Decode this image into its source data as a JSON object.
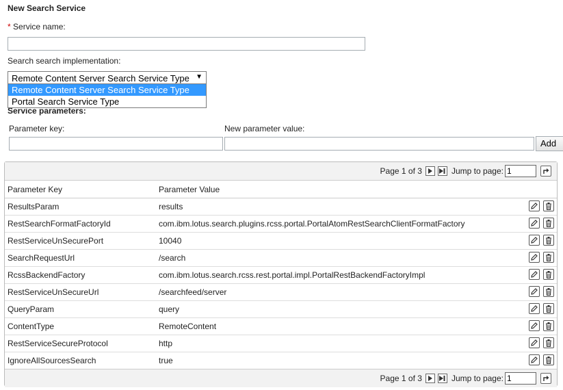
{
  "form": {
    "title": "New Search Service",
    "required_mark": "*",
    "service_name_label": "Service name:",
    "service_name_value": "",
    "impl_label": "Search search implementation:",
    "impl_selected": "Remote Content Server Search Service Type",
    "impl_options": [
      "Remote Content Server Search Service Type",
      "Portal Search Service Type"
    ],
    "params_label": "Service parameters:",
    "param_key_label": "Parameter key:",
    "param_value_label": "New parameter value:",
    "add_label": "Add"
  },
  "pager": {
    "page_text": "Page 1 of 3",
    "jump_label": "Jump to page:",
    "jump_value": "1"
  },
  "table": {
    "col_key": "Parameter Key",
    "col_value": "Parameter Value",
    "rows": [
      {
        "key": "ResultsParam",
        "value": "results"
      },
      {
        "key": "RestSearchFormatFactoryId",
        "value": "com.ibm.lotus.search.plugins.rcss.portal.PortalAtomRestSearchClientFormatFactory"
      },
      {
        "key": "RestServiceUnSecurePort",
        "value": "10040"
      },
      {
        "key": "SearchRequestUrl",
        "value": "/search"
      },
      {
        "key": "RcssBackendFactory",
        "value": "com.ibm.lotus.search.rcss.rest.portal.impl.PortalRestBackendFactoryImpl"
      },
      {
        "key": "RestServiceUnSecureUrl",
        "value": "/searchfeed/server"
      },
      {
        "key": "QueryParam",
        "value": "query"
      },
      {
        "key": "ContentType",
        "value": "RemoteContent"
      },
      {
        "key": "RestServiceSecureProtocol",
        "value": "http"
      },
      {
        "key": "IgnoreAllSourcesSearch",
        "value": "true"
      }
    ]
  },
  "icons": {
    "next": "next-page-icon",
    "last": "last-page-icon",
    "go": "go-icon",
    "edit": "pencil-icon",
    "delete": "trash-icon"
  }
}
